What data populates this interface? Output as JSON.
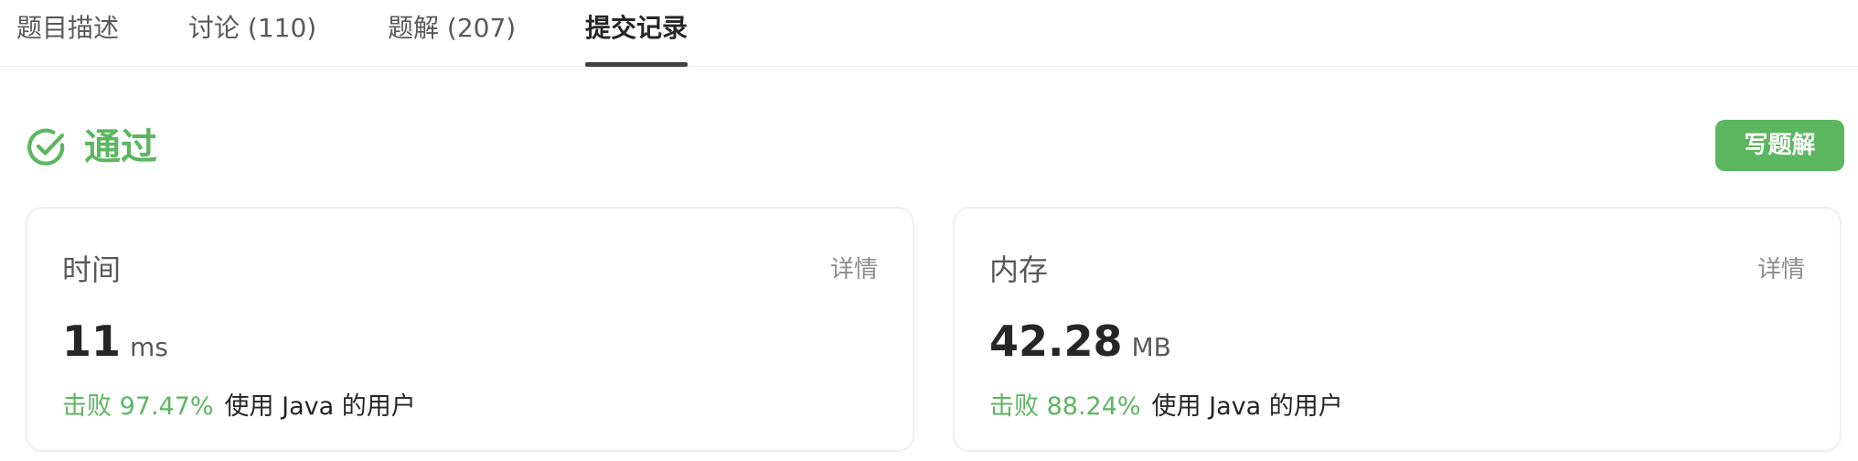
{
  "tabs": [
    {
      "label": "题目描述",
      "active": false
    },
    {
      "label": "讨论 (110)",
      "active": false
    },
    {
      "label": "题解 (207)",
      "active": false
    },
    {
      "label": "提交记录",
      "active": true
    }
  ],
  "status": {
    "label": "通过",
    "icon": "check-circle-icon",
    "color": "#5cb660"
  },
  "write_solution_label": "写题解",
  "cards": [
    {
      "title": "时间",
      "detail_label": "详情",
      "value": "11",
      "unit": "ms",
      "beat": "击败 97.47%",
      "beat_suffix": "使用 Java 的用户"
    },
    {
      "title": "内存",
      "detail_label": "详情",
      "value": "42.28",
      "unit": "MB",
      "beat": "击败 88.24%",
      "beat_suffix": "使用 Java 的用户"
    }
  ],
  "colors": {
    "accent": "#5cb660",
    "text": "#262626",
    "muted": "#8c8c8c"
  }
}
